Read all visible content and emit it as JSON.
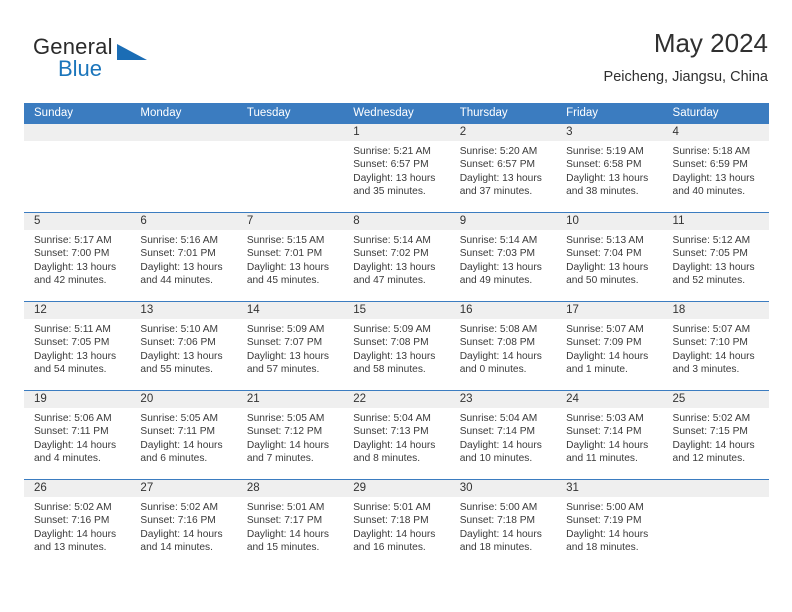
{
  "brand": {
    "name_top": "General",
    "name_bottom": "Blue",
    "accent_color": "#1b6db5"
  },
  "header": {
    "title": "May 2024",
    "location": "Peicheng, Jiangsu, China",
    "header_bg": "#3b7cc0"
  },
  "weekdays": [
    "Sunday",
    "Monday",
    "Tuesday",
    "Wednesday",
    "Thursday",
    "Friday",
    "Saturday"
  ],
  "weeks": [
    [
      {
        "day": "",
        "empty": true,
        "sunrise": "",
        "sunset": "",
        "daylight1": "",
        "daylight2": ""
      },
      {
        "day": "",
        "empty": true,
        "sunrise": "",
        "sunset": "",
        "daylight1": "",
        "daylight2": ""
      },
      {
        "day": "",
        "empty": true,
        "sunrise": "",
        "sunset": "",
        "daylight1": "",
        "daylight2": ""
      },
      {
        "day": "1",
        "empty": false,
        "sunrise": "Sunrise: 5:21 AM",
        "sunset": "Sunset: 6:57 PM",
        "daylight1": "Daylight: 13 hours",
        "daylight2": "and 35 minutes."
      },
      {
        "day": "2",
        "empty": false,
        "sunrise": "Sunrise: 5:20 AM",
        "sunset": "Sunset: 6:57 PM",
        "daylight1": "Daylight: 13 hours",
        "daylight2": "and 37 minutes."
      },
      {
        "day": "3",
        "empty": false,
        "sunrise": "Sunrise: 5:19 AM",
        "sunset": "Sunset: 6:58 PM",
        "daylight1": "Daylight: 13 hours",
        "daylight2": "and 38 minutes."
      },
      {
        "day": "4",
        "empty": false,
        "sunrise": "Sunrise: 5:18 AM",
        "sunset": "Sunset: 6:59 PM",
        "daylight1": "Daylight: 13 hours",
        "daylight2": "and 40 minutes."
      }
    ],
    [
      {
        "day": "5",
        "empty": false,
        "sunrise": "Sunrise: 5:17 AM",
        "sunset": "Sunset: 7:00 PM",
        "daylight1": "Daylight: 13 hours",
        "daylight2": "and 42 minutes."
      },
      {
        "day": "6",
        "empty": false,
        "sunrise": "Sunrise: 5:16 AM",
        "sunset": "Sunset: 7:01 PM",
        "daylight1": "Daylight: 13 hours",
        "daylight2": "and 44 minutes."
      },
      {
        "day": "7",
        "empty": false,
        "sunrise": "Sunrise: 5:15 AM",
        "sunset": "Sunset: 7:01 PM",
        "daylight1": "Daylight: 13 hours",
        "daylight2": "and 45 minutes."
      },
      {
        "day": "8",
        "empty": false,
        "sunrise": "Sunrise: 5:14 AM",
        "sunset": "Sunset: 7:02 PM",
        "daylight1": "Daylight: 13 hours",
        "daylight2": "and 47 minutes."
      },
      {
        "day": "9",
        "empty": false,
        "sunrise": "Sunrise: 5:14 AM",
        "sunset": "Sunset: 7:03 PM",
        "daylight1": "Daylight: 13 hours",
        "daylight2": "and 49 minutes."
      },
      {
        "day": "10",
        "empty": false,
        "sunrise": "Sunrise: 5:13 AM",
        "sunset": "Sunset: 7:04 PM",
        "daylight1": "Daylight: 13 hours",
        "daylight2": "and 50 minutes."
      },
      {
        "day": "11",
        "empty": false,
        "sunrise": "Sunrise: 5:12 AM",
        "sunset": "Sunset: 7:05 PM",
        "daylight1": "Daylight: 13 hours",
        "daylight2": "and 52 minutes."
      }
    ],
    [
      {
        "day": "12",
        "empty": false,
        "sunrise": "Sunrise: 5:11 AM",
        "sunset": "Sunset: 7:05 PM",
        "daylight1": "Daylight: 13 hours",
        "daylight2": "and 54 minutes."
      },
      {
        "day": "13",
        "empty": false,
        "sunrise": "Sunrise: 5:10 AM",
        "sunset": "Sunset: 7:06 PM",
        "daylight1": "Daylight: 13 hours",
        "daylight2": "and 55 minutes."
      },
      {
        "day": "14",
        "empty": false,
        "sunrise": "Sunrise: 5:09 AM",
        "sunset": "Sunset: 7:07 PM",
        "daylight1": "Daylight: 13 hours",
        "daylight2": "and 57 minutes."
      },
      {
        "day": "15",
        "empty": false,
        "sunrise": "Sunrise: 5:09 AM",
        "sunset": "Sunset: 7:08 PM",
        "daylight1": "Daylight: 13 hours",
        "daylight2": "and 58 minutes."
      },
      {
        "day": "16",
        "empty": false,
        "sunrise": "Sunrise: 5:08 AM",
        "sunset": "Sunset: 7:08 PM",
        "daylight1": "Daylight: 14 hours",
        "daylight2": "and 0 minutes."
      },
      {
        "day": "17",
        "empty": false,
        "sunrise": "Sunrise: 5:07 AM",
        "sunset": "Sunset: 7:09 PM",
        "daylight1": "Daylight: 14 hours",
        "daylight2": "and 1 minute."
      },
      {
        "day": "18",
        "empty": false,
        "sunrise": "Sunrise: 5:07 AM",
        "sunset": "Sunset: 7:10 PM",
        "daylight1": "Daylight: 14 hours",
        "daylight2": "and 3 minutes."
      }
    ],
    [
      {
        "day": "19",
        "empty": false,
        "sunrise": "Sunrise: 5:06 AM",
        "sunset": "Sunset: 7:11 PM",
        "daylight1": "Daylight: 14 hours",
        "daylight2": "and 4 minutes."
      },
      {
        "day": "20",
        "empty": false,
        "sunrise": "Sunrise: 5:05 AM",
        "sunset": "Sunset: 7:11 PM",
        "daylight1": "Daylight: 14 hours",
        "daylight2": "and 6 minutes."
      },
      {
        "day": "21",
        "empty": false,
        "sunrise": "Sunrise: 5:05 AM",
        "sunset": "Sunset: 7:12 PM",
        "daylight1": "Daylight: 14 hours",
        "daylight2": "and 7 minutes."
      },
      {
        "day": "22",
        "empty": false,
        "sunrise": "Sunrise: 5:04 AM",
        "sunset": "Sunset: 7:13 PM",
        "daylight1": "Daylight: 14 hours",
        "daylight2": "and 8 minutes."
      },
      {
        "day": "23",
        "empty": false,
        "sunrise": "Sunrise: 5:04 AM",
        "sunset": "Sunset: 7:14 PM",
        "daylight1": "Daylight: 14 hours",
        "daylight2": "and 10 minutes."
      },
      {
        "day": "24",
        "empty": false,
        "sunrise": "Sunrise: 5:03 AM",
        "sunset": "Sunset: 7:14 PM",
        "daylight1": "Daylight: 14 hours",
        "daylight2": "and 11 minutes."
      },
      {
        "day": "25",
        "empty": false,
        "sunrise": "Sunrise: 5:02 AM",
        "sunset": "Sunset: 7:15 PM",
        "daylight1": "Daylight: 14 hours",
        "daylight2": "and 12 minutes."
      }
    ],
    [
      {
        "day": "26",
        "empty": false,
        "sunrise": "Sunrise: 5:02 AM",
        "sunset": "Sunset: 7:16 PM",
        "daylight1": "Daylight: 14 hours",
        "daylight2": "and 13 minutes."
      },
      {
        "day": "27",
        "empty": false,
        "sunrise": "Sunrise: 5:02 AM",
        "sunset": "Sunset: 7:16 PM",
        "daylight1": "Daylight: 14 hours",
        "daylight2": "and 14 minutes."
      },
      {
        "day": "28",
        "empty": false,
        "sunrise": "Sunrise: 5:01 AM",
        "sunset": "Sunset: 7:17 PM",
        "daylight1": "Daylight: 14 hours",
        "daylight2": "and 15 minutes."
      },
      {
        "day": "29",
        "empty": false,
        "sunrise": "Sunrise: 5:01 AM",
        "sunset": "Sunset: 7:18 PM",
        "daylight1": "Daylight: 14 hours",
        "daylight2": "and 16 minutes."
      },
      {
        "day": "30",
        "empty": false,
        "sunrise": "Sunrise: 5:00 AM",
        "sunset": "Sunset: 7:18 PM",
        "daylight1": "Daylight: 14 hours",
        "daylight2": "and 18 minutes."
      },
      {
        "day": "31",
        "empty": false,
        "sunrise": "Sunrise: 5:00 AM",
        "sunset": "Sunset: 7:19 PM",
        "daylight1": "Daylight: 14 hours",
        "daylight2": "and 18 minutes."
      },
      {
        "day": "",
        "empty": true,
        "sunrise": "",
        "sunset": "",
        "daylight1": "",
        "daylight2": ""
      }
    ]
  ]
}
